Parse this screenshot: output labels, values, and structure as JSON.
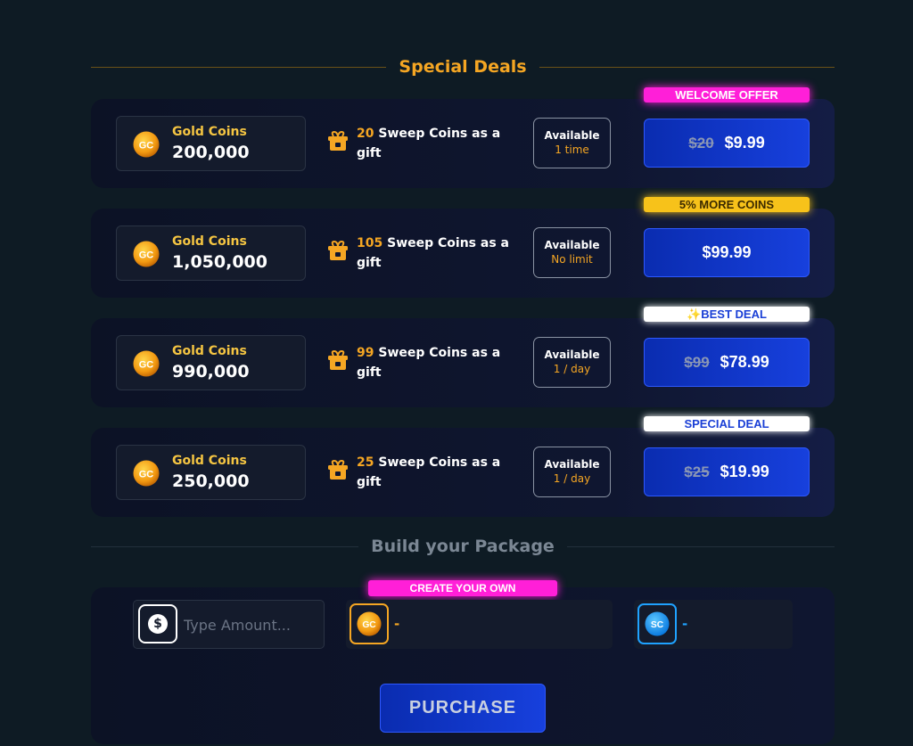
{
  "header": {
    "title": "Special Deals"
  },
  "deals": [
    {
      "badge": "WELCOME OFFER",
      "coin_label": "Gold Coins",
      "coin_amount": "200,000",
      "gift_count": "20",
      "gift_text": "Sweep Coins as a gift",
      "avail_label": "Available",
      "avail_value": "1 time",
      "old_price": "$20",
      "price": "$9.99"
    },
    {
      "badge": "5% MORE COINS",
      "coin_label": "Gold Coins",
      "coin_amount": "1,050,000",
      "gift_count": "105",
      "gift_text": "Sweep Coins as a gift",
      "avail_label": "Available",
      "avail_value": "No limit",
      "old_price": "",
      "price": "$99.99"
    },
    {
      "badge": "✨BEST DEAL",
      "coin_label": "Gold Coins",
      "coin_amount": "990,000",
      "gift_count": "99",
      "gift_text": "Sweep Coins as a gift",
      "avail_label": "Available",
      "avail_value": "1 / day",
      "old_price": "$99",
      "price": "$78.99"
    },
    {
      "badge": "SPECIAL DEAL",
      "coin_label": "Gold Coins",
      "coin_amount": "250,000",
      "gift_count": "25",
      "gift_text": "Sweep Coins as a gift",
      "avail_label": "Available",
      "avail_value": "1 / day",
      "old_price": "$25",
      "price": "$19.99"
    }
  ],
  "build": {
    "title": "Build your Package",
    "badge": "CREATE YOUR OWN",
    "amount_placeholder": "Type Amount...",
    "gc_icon_text": "GC",
    "gc_value": "-",
    "sc_icon_text": "SC",
    "sc_value": "-",
    "dollar_icon": "$",
    "purchase_label": "PURCHASE"
  },
  "icons": {
    "gold_coin": "gc-coin-icon",
    "gift": "gift-icon",
    "sweep_coin": "sc-coin-icon",
    "dollar": "dollar-icon"
  },
  "colors": {
    "accent_gold": "#f5a623",
    "accent_blue": "#1740dd",
    "badge_magenta": "#ff1fd8",
    "badge_yellow": "#f7c21a",
    "sc_blue": "#1fa2ff"
  }
}
